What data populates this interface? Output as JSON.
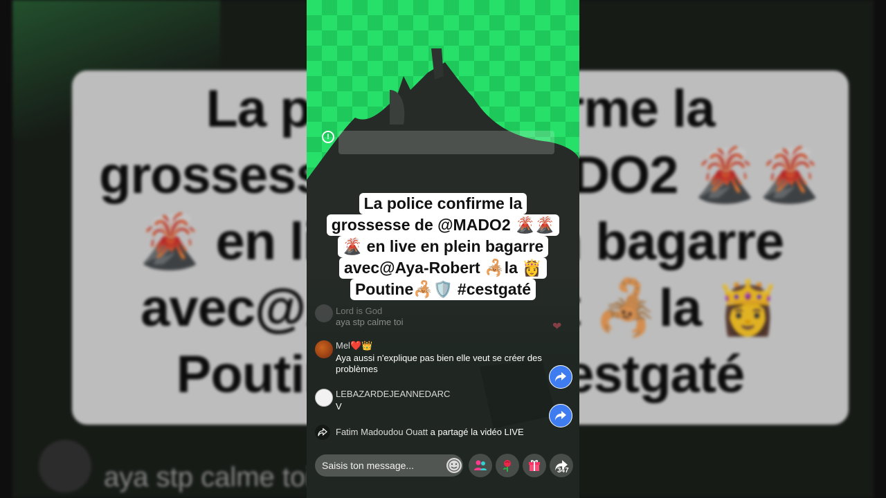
{
  "caption": {
    "lines": [
      "La police confirme la",
      "grossesse de @MADO2 🌋🌋",
      "🌋 en live en plein bagarre",
      "avec@Aya-Robert 🦂la 👸",
      "Poutine🦂🛡️ #cestgaté"
    ]
  },
  "comments": [
    {
      "user": "Lord is God",
      "text": "aya stp calme toi"
    },
    {
      "user": "Mel❤️👑",
      "text": "Aya aussi n'explique pas bien elle veut se créer des problèmes"
    },
    {
      "user": "LEBAZARDEJEANNEDARC",
      "text": "V"
    }
  ],
  "share_event": {
    "user": "Fatim Madoudou Ouatt",
    "action": " a partagé la vidéo LIVE"
  },
  "bottom_bar": {
    "input_placeholder": "Saisis ton message...",
    "share_count": "347"
  },
  "backdrop": {
    "text": "La police confirme la grossesse de @MADO2 🌋🌋 🌋 en live en plein bagarre avec@Aya-Robert 🦂la 👸 Poutine🦂🛡️ #cestgaté",
    "comment": "aya stp calme toi"
  },
  "colors": {
    "screen_green": "#27e06a",
    "share_blue": "#3f7cf0",
    "caption_bg": "#ffffff"
  }
}
